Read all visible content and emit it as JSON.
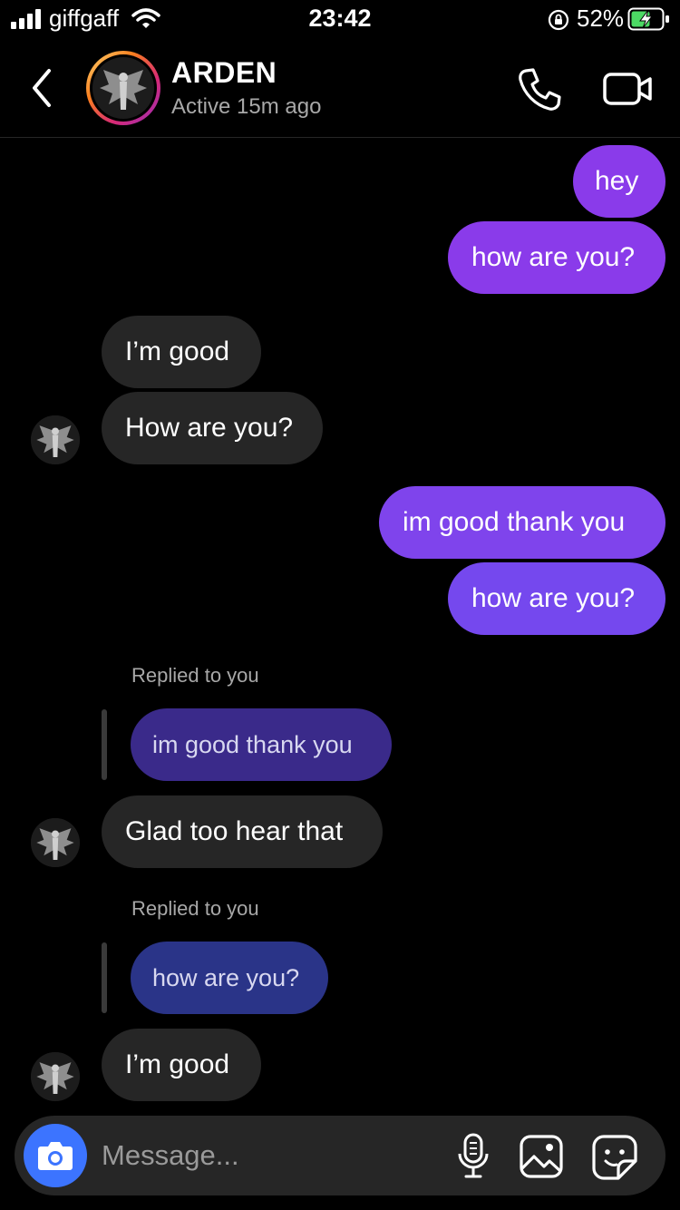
{
  "status_bar": {
    "carrier": "giffgaff",
    "time": "23:42",
    "battery_percent": "52%"
  },
  "header": {
    "contact_name": "ARDEN",
    "contact_status": "Active 15m ago"
  },
  "messages": [
    {
      "from": "me",
      "text": "hey"
    },
    {
      "from": "me",
      "text": "how are you?"
    },
    {
      "from": "them",
      "text": "I’m good"
    },
    {
      "from": "them",
      "text": "How are you?"
    },
    {
      "from": "me",
      "text": "im good thank you"
    },
    {
      "from": "me",
      "text": "how are you?"
    },
    {
      "from": "them",
      "reply_label": "Replied to you",
      "quoted_text": "im good thank you",
      "text": "Glad too hear that"
    },
    {
      "from": "them",
      "reply_label": "Replied to you",
      "quoted_text": "how are you?",
      "text": "I’m good"
    }
  ],
  "composer": {
    "placeholder": "Message..."
  },
  "colors": {
    "outgoing_bubble": "#8a3bea",
    "incoming_bubble": "#262626",
    "camera_button": "#3c74ff"
  }
}
